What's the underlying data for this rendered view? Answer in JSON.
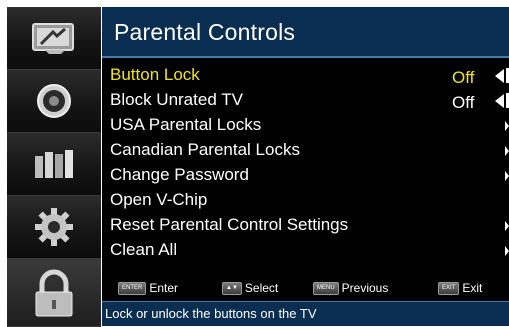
{
  "rail": {
    "icons": [
      "picture-icon",
      "audio-icon",
      "channels-icon",
      "settings-icon",
      "lock-icon"
    ]
  },
  "header": {
    "title": "Parental Controls"
  },
  "menu": {
    "items": [
      {
        "label": "Button Lock",
        "value": "Off",
        "selected": true
      },
      {
        "label": "Block Unrated TV",
        "value": "Off",
        "selected": false
      },
      {
        "label": "USA Parental Locks"
      },
      {
        "label": "Canadian Parental Locks"
      },
      {
        "label": "Change Password"
      },
      {
        "label": "Open V-Chip"
      },
      {
        "label": "Reset Parental Control Settings"
      },
      {
        "label": "Clean All"
      }
    ]
  },
  "hints": {
    "enter": {
      "key": "ENTER",
      "label": "Enter"
    },
    "select": {
      "label": "Select"
    },
    "previous": {
      "key": "MENU",
      "label": "Previous"
    },
    "exit": {
      "key": "EXIT",
      "label": "Exit"
    }
  },
  "status": {
    "text": "Lock or unlock the buttons on the TV"
  },
  "colors": {
    "header_bg": "#0a2e52",
    "highlight": "#f3e41a",
    "panel_bg": "#000000"
  }
}
